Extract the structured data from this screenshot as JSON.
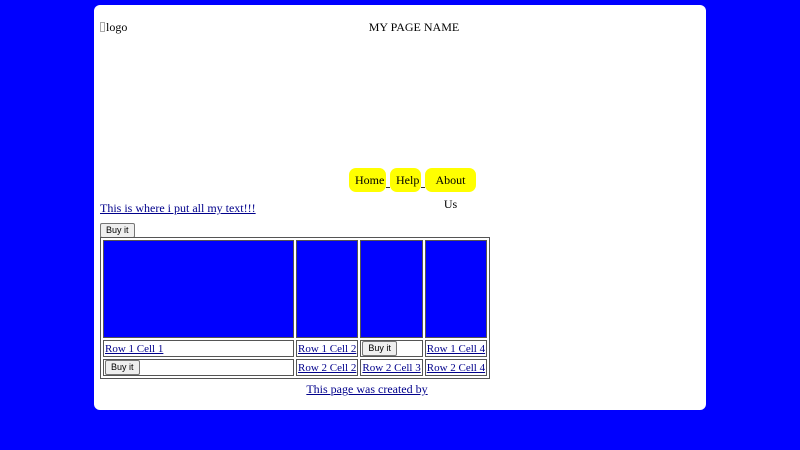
{
  "header": {
    "logo_alt": "logo",
    "title": "MY PAGE NAME"
  },
  "nav": {
    "items": [
      {
        "label": "Home"
      },
      {
        "label": "Help"
      },
      {
        "label": "About Us"
      }
    ],
    "button_color": "#ffff00"
  },
  "main": {
    "intro_text": "This is where i put all my text!!!",
    "buy_button_label": "Buy it"
  },
  "table": {
    "row1": [
      "Row 1 Cell 1",
      "Row 1 Cell 2",
      "Buy it",
      "Row 1 Cell 4"
    ],
    "row2": [
      "Buy it",
      "Row 2 Cell 2",
      "Row 2 Cell 3",
      "Row 2 Cell 4"
    ]
  },
  "footer": {
    "text": "This page was created by"
  },
  "colors": {
    "background": "#0000ff",
    "panel": "#ffffff",
    "link": "#00008b"
  }
}
